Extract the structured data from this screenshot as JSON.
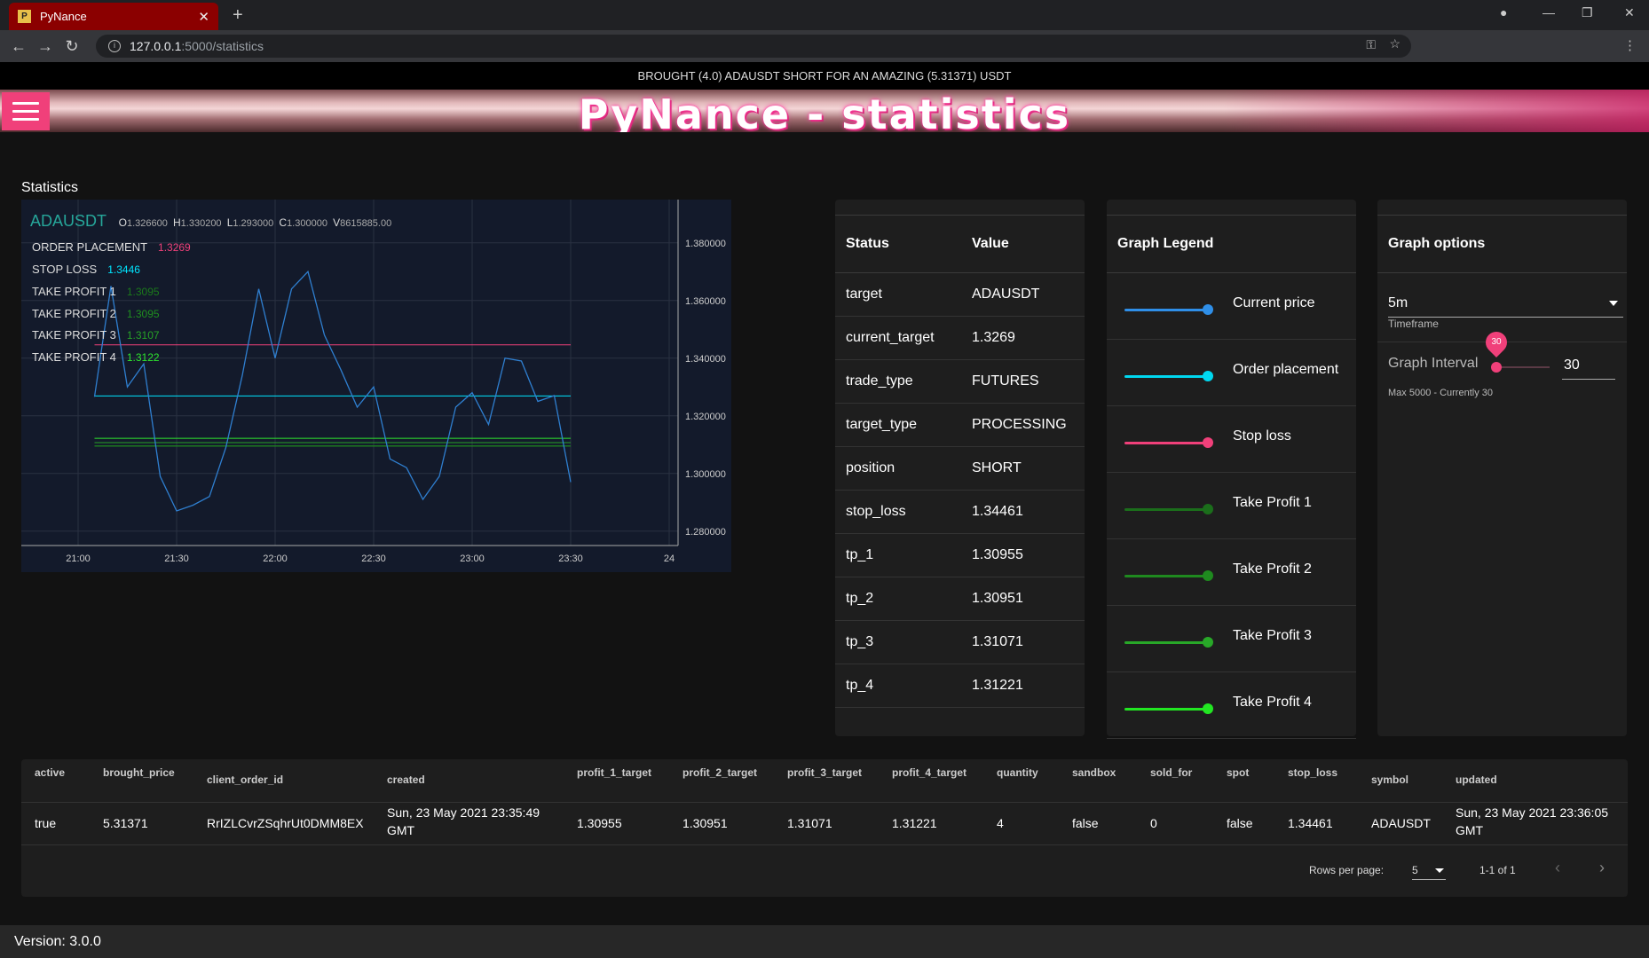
{
  "browser": {
    "tab_title": "PyNance",
    "url_host": "127.0.0.1",
    "url_path": ":5000/statistics"
  },
  "notice": "BROUGHT (4.0) ADAUSDT SHORT FOR AN AMAZING (5.31371) USDT",
  "banner_title": "PyNance - statistics",
  "section_title": "Statistics",
  "chart_data": {
    "type": "line",
    "symbol": "ADAUSDT",
    "ohlc": {
      "O": "1.326600",
      "H": "1.330200",
      "L": "1.293000",
      "C": "1.300000",
      "V": "8615885.00"
    },
    "x_ticks": [
      "21:00",
      "21:30",
      "22:00",
      "22:30",
      "23:00",
      "23:30",
      "24"
    ],
    "y_ticks": [
      "1.380000",
      "1.360000",
      "1.340000",
      "1.320000",
      "1.300000",
      "1.280000"
    ],
    "ylim": [
      1.275,
      1.395
    ],
    "price_series": {
      "name": "ADAUSDT",
      "x_minutes": [
        80,
        85,
        90,
        95,
        100,
        105,
        110,
        115,
        120,
        125,
        130,
        135,
        140,
        145,
        150,
        155,
        160,
        165,
        170,
        175,
        180,
        185,
        190,
        195,
        200,
        205,
        210,
        215,
        220,
        225,
        230,
        235
      ],
      "values": [
        1.3266,
        1.365,
        1.33,
        1.338,
        1.299,
        1.287,
        1.289,
        1.292,
        1.309,
        1.334,
        1.364,
        1.34,
        1.364,
        1.37,
        1.348,
        1.336,
        1.323,
        1.33,
        1.305,
        1.302,
        1.291,
        1.299,
        1.323,
        1.328,
        1.317,
        1.34,
        1.339,
        1.325,
        1.327,
        1.297
      ]
    },
    "levels": [
      {
        "name": "ORDER PLACEMENT",
        "value": "1.3269",
        "color": "#f0407a",
        "y": 1.3446
      },
      {
        "name": "STOP LOSS",
        "value": "1.3446",
        "color": "#00e5ff",
        "y": 1.3269
      },
      {
        "name": "TAKE PROFIT 1",
        "value": "1.3095",
        "color": "#1b7a1b",
        "y": 1.30955
      },
      {
        "name": "TAKE PROFIT 2",
        "value": "1.3095",
        "color": "#1f8f1f",
        "y": 1.30951
      },
      {
        "name": "TAKE PROFIT 3",
        "value": "1.3107",
        "color": "#27a327",
        "y": 1.31071
      },
      {
        "name": "TAKE PROFIT 4",
        "value": "1.3122",
        "color": "#2ee62e",
        "y": 1.31221
      }
    ]
  },
  "status_card": {
    "headers": [
      "Status",
      "Value"
    ],
    "rows": [
      [
        "target",
        "ADAUSDT"
      ],
      [
        "current_target",
        "1.3269"
      ],
      [
        "trade_type",
        "FUTURES"
      ],
      [
        "target_type",
        "PROCESSING"
      ],
      [
        "position",
        "SHORT"
      ],
      [
        "stop_loss",
        "1.34461"
      ],
      [
        "tp_1",
        "1.30955"
      ],
      [
        "tp_2",
        "1.30951"
      ],
      [
        "tp_3",
        "1.31071"
      ],
      [
        "tp_4",
        "1.31221"
      ]
    ]
  },
  "legend_card": {
    "title": "Graph Legend",
    "items": [
      {
        "label": "Current price",
        "color": "#2f8fe8"
      },
      {
        "label": "Order placement",
        "color": "#00d8f0"
      },
      {
        "label": "Stop loss",
        "color": "#f0407a"
      },
      {
        "label": "Take Profit 1",
        "color": "#1b6e1b"
      },
      {
        "label": "Take Profit 2",
        "color": "#1f8a1f"
      },
      {
        "label": "Take Profit 3",
        "color": "#28a828"
      },
      {
        "label": "Take Profit 4",
        "color": "#22e622"
      }
    ]
  },
  "options_card": {
    "title": "Graph options",
    "timeframe_value": "5m",
    "timeframe_label": "Timeframe",
    "interval_label": "Graph Interval",
    "interval_value": "30",
    "interval_bubble": "30",
    "interval_fraction": 0.006,
    "interval_note": "Max 5000 - Currently 30"
  },
  "trade_table": {
    "headers": [
      "active",
      "brought_price",
      "client_order_id",
      "created",
      "profit_1_target",
      "profit_2_target",
      "profit_3_target",
      "profit_4_target",
      "quantity",
      "sandbox",
      "sold_for",
      "spot",
      "stop_loss",
      "symbol",
      "updated"
    ],
    "row": [
      "true",
      "5.31371",
      "RrIZLCvrZSqhrUt0DMM8EX",
      "Sun, 23 May 2021 23:35:49 GMT",
      "1.30955",
      "1.30951",
      "1.31071",
      "1.31221",
      "4",
      "false",
      "0",
      "false",
      "1.34461",
      "ADAUSDT",
      "Sun, 23 May 2021 23:36:05 GMT"
    ],
    "rows_per_page_label": "Rows per page:",
    "rows_per_page": "5",
    "range": "1-1 of 1"
  },
  "footer": "Version: 3.0.0"
}
